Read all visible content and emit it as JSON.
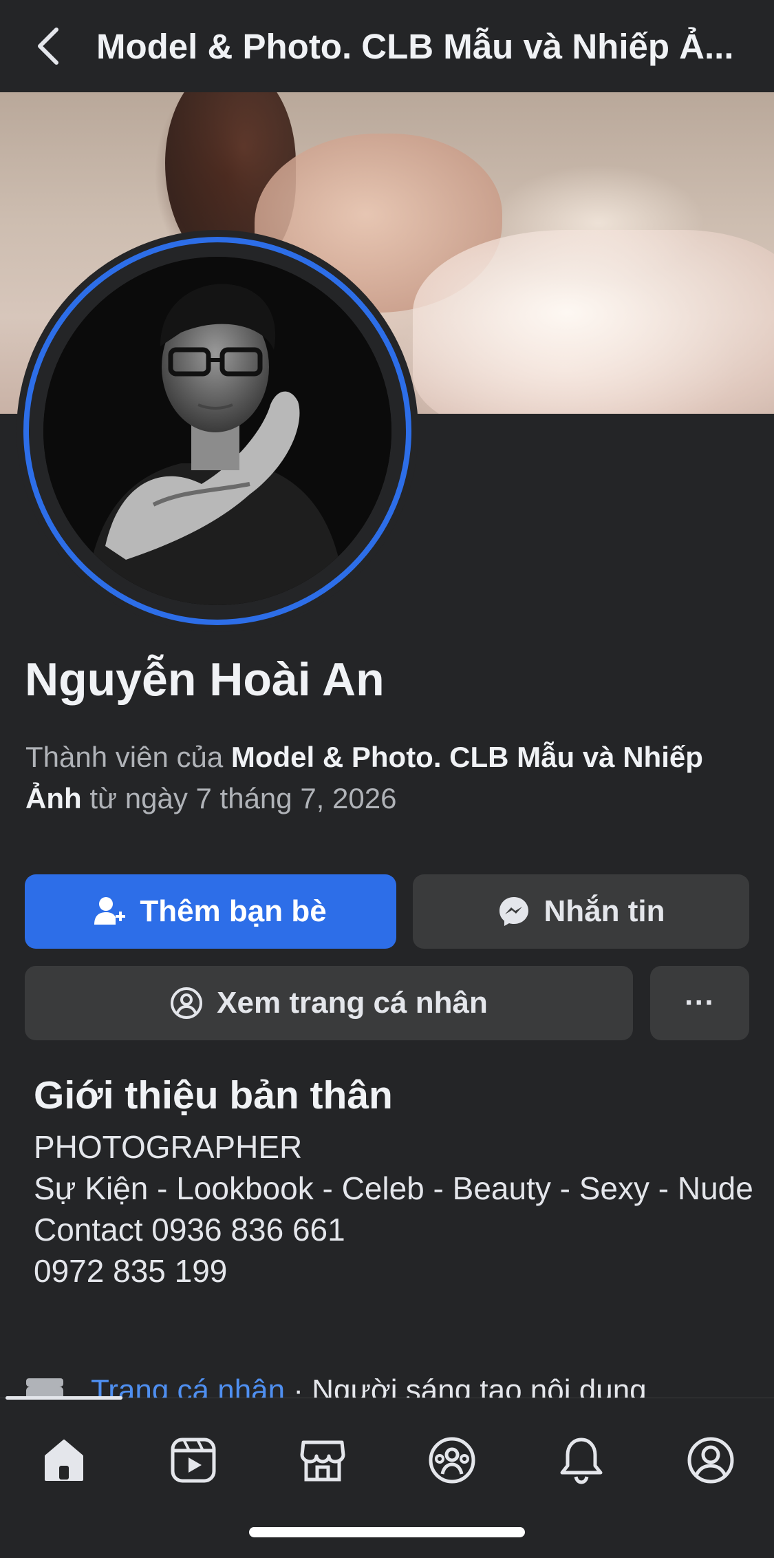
{
  "header": {
    "title": "Model & Photo. CLB Mẫu và Nhiếp Ả..."
  },
  "profile": {
    "name": "Nguyễn Hoài An",
    "member_prefix": "Thành viên của ",
    "group_name": "Model & Photo. CLB Mẫu và Nhiếp Ảnh",
    "member_suffix": " từ ngày 7 tháng 7, 2026"
  },
  "actions": {
    "add_friend": "Thêm bạn bè",
    "message": "Nhắn tin",
    "view_profile": "Xem trang cá nhân",
    "more": "···"
  },
  "intro": {
    "title": "Giới thiệu bản thân",
    "body": "PHOTOGRAPHER\nSự Kiện - Lookbook - Celeb - Beauty - Sexy - Nude\nContact 0936 836 661\n0972 835 199"
  },
  "profile_link": {
    "link_text": "Trang cá nhân",
    "rest_text": " · Người sáng tạo nội dung"
  },
  "tabbar": {
    "items": [
      {
        "icon": "home-icon",
        "active": true
      },
      {
        "icon": "video-icon",
        "active": false
      },
      {
        "icon": "marketplace-icon",
        "active": false
      },
      {
        "icon": "groups-icon",
        "active": false
      },
      {
        "icon": "bell-icon",
        "active": false
      },
      {
        "icon": "profile-icon",
        "active": false
      }
    ]
  },
  "colors": {
    "background": "#242527",
    "accent": "#2d6ee8",
    "button_secondary": "#3a3b3c",
    "link": "#4f8ff0"
  }
}
